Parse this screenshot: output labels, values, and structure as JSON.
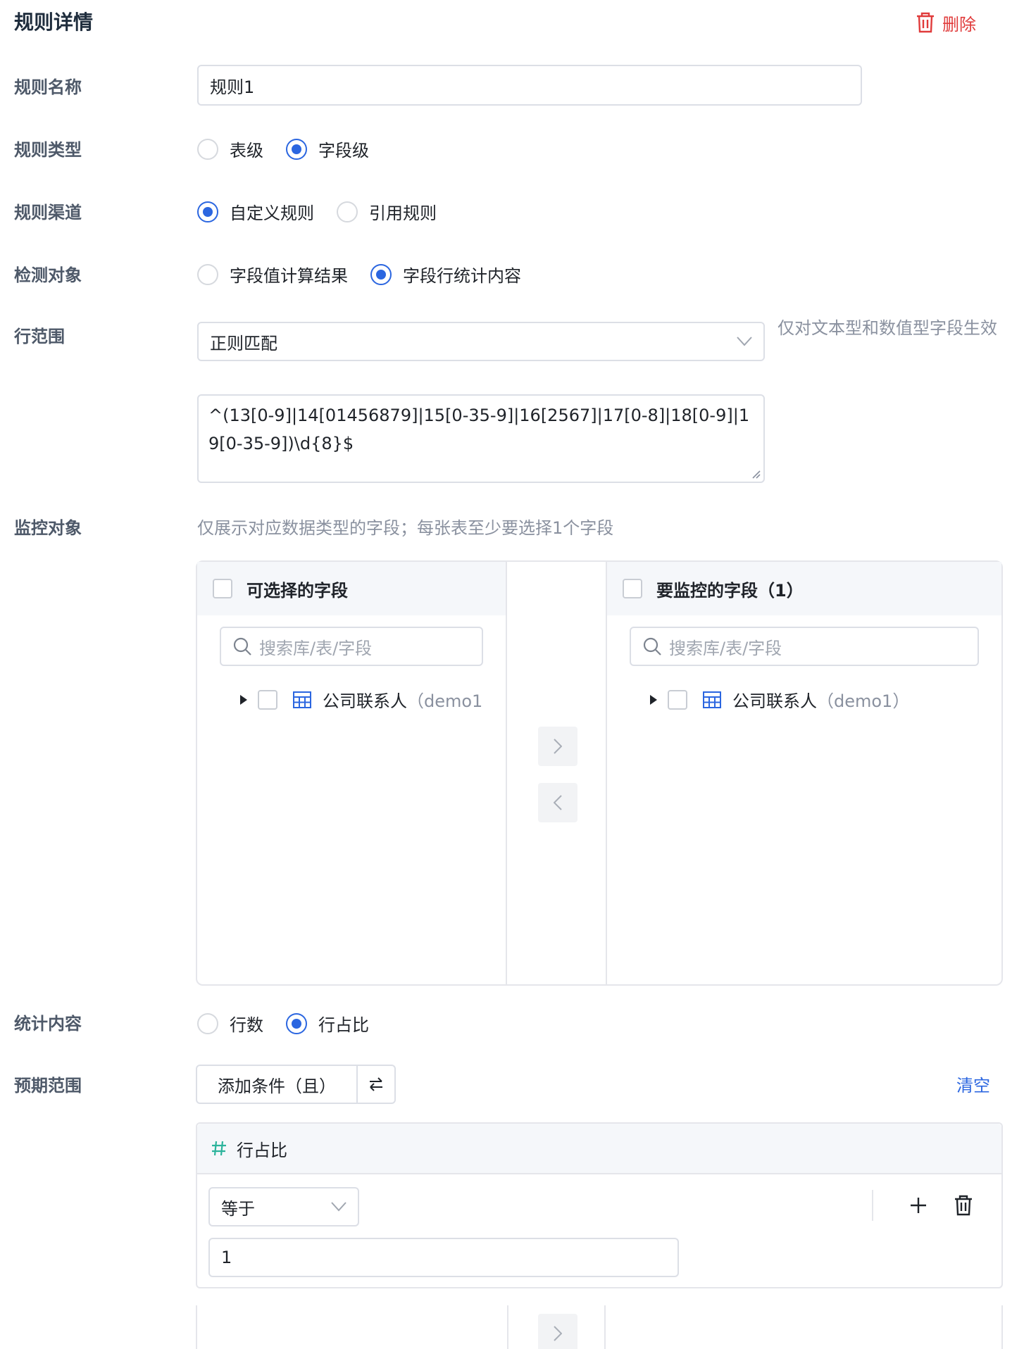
{
  "header": {
    "title": "规则详情",
    "delete_label": "删除"
  },
  "rule_name": {
    "label": "规则名称",
    "value": "规则1"
  },
  "rule_type": {
    "label": "规则类型",
    "options": [
      "表级",
      "字段级"
    ],
    "selected": "字段级"
  },
  "rule_channel": {
    "label": "规则渠道",
    "options": [
      "自定义规则",
      "引用规则"
    ],
    "selected": "自定义规则"
  },
  "detect_target": {
    "label": "检测对象",
    "options": [
      "字段值计算结果",
      "字段行统计内容"
    ],
    "selected": "字段行统计内容"
  },
  "row_range": {
    "label": "行范围",
    "select_value": "正则匹配",
    "hint": "仅对文本型和数值型字段生效",
    "regex": "^(13[0-9]|14[01456879]|15[0-35-9]|16[2567]|17[0-8]|18[0-9]|19[0-35-9])\\d{8}$"
  },
  "monitor": {
    "label": "监控对象",
    "hint": "仅展示对应数据类型的字段；每张表至少要选择1个字段",
    "left_panel": {
      "title": "可选择的字段",
      "search_placeholder": "搜索库/表/字段",
      "item_name": "公司联系人",
      "item_db": "（demo1"
    },
    "right_panel": {
      "title": "要监控的字段（1）",
      "search_placeholder": "搜索库/表/字段",
      "item_name": "公司联系人",
      "item_db": "（demo1）"
    }
  },
  "stat_content": {
    "label": "统计内容",
    "options": [
      "行数",
      "行占比"
    ],
    "selected": "行占比"
  },
  "expected_range": {
    "label": "预期范围",
    "add_condition_label": "添加条件（且）",
    "clear_label": "清空",
    "condition": {
      "field": "行占比",
      "operator": "等于",
      "value": "1"
    }
  },
  "colors": {
    "primary": "#2b66e0",
    "danger": "#e03b3b",
    "hash_icon": "#2bb39b"
  }
}
